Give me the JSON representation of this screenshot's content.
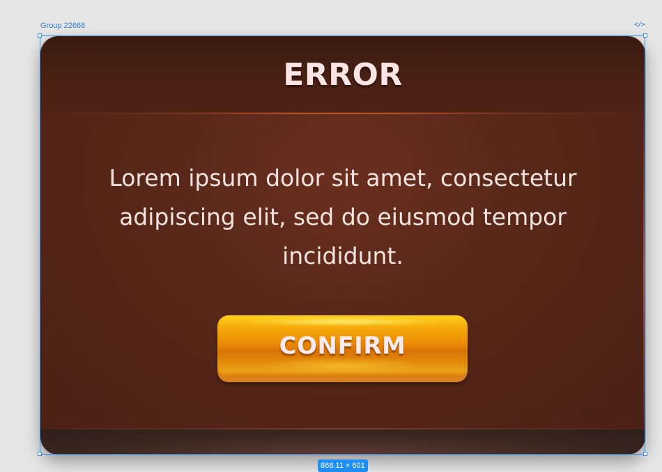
{
  "editor": {
    "frame_label": "Group 22668",
    "code_icon": "</>",
    "size_badge": "868.11 × 601"
  },
  "dialog": {
    "title": "ERROR",
    "message": "Lorem ipsum dolor sit amet, consectetur adipiscing elit, sed do eiusmod tempor incididunt.",
    "confirm_label": "CONFIRM"
  },
  "colors": {
    "dialog_background": "#4b2214",
    "title_text": "#fce4e4",
    "button_top": "#ffd21a",
    "button_bottom": "#d97308",
    "selection_accent": "#2f8cf0"
  },
  "icons": {
    "code": "code-icon"
  }
}
